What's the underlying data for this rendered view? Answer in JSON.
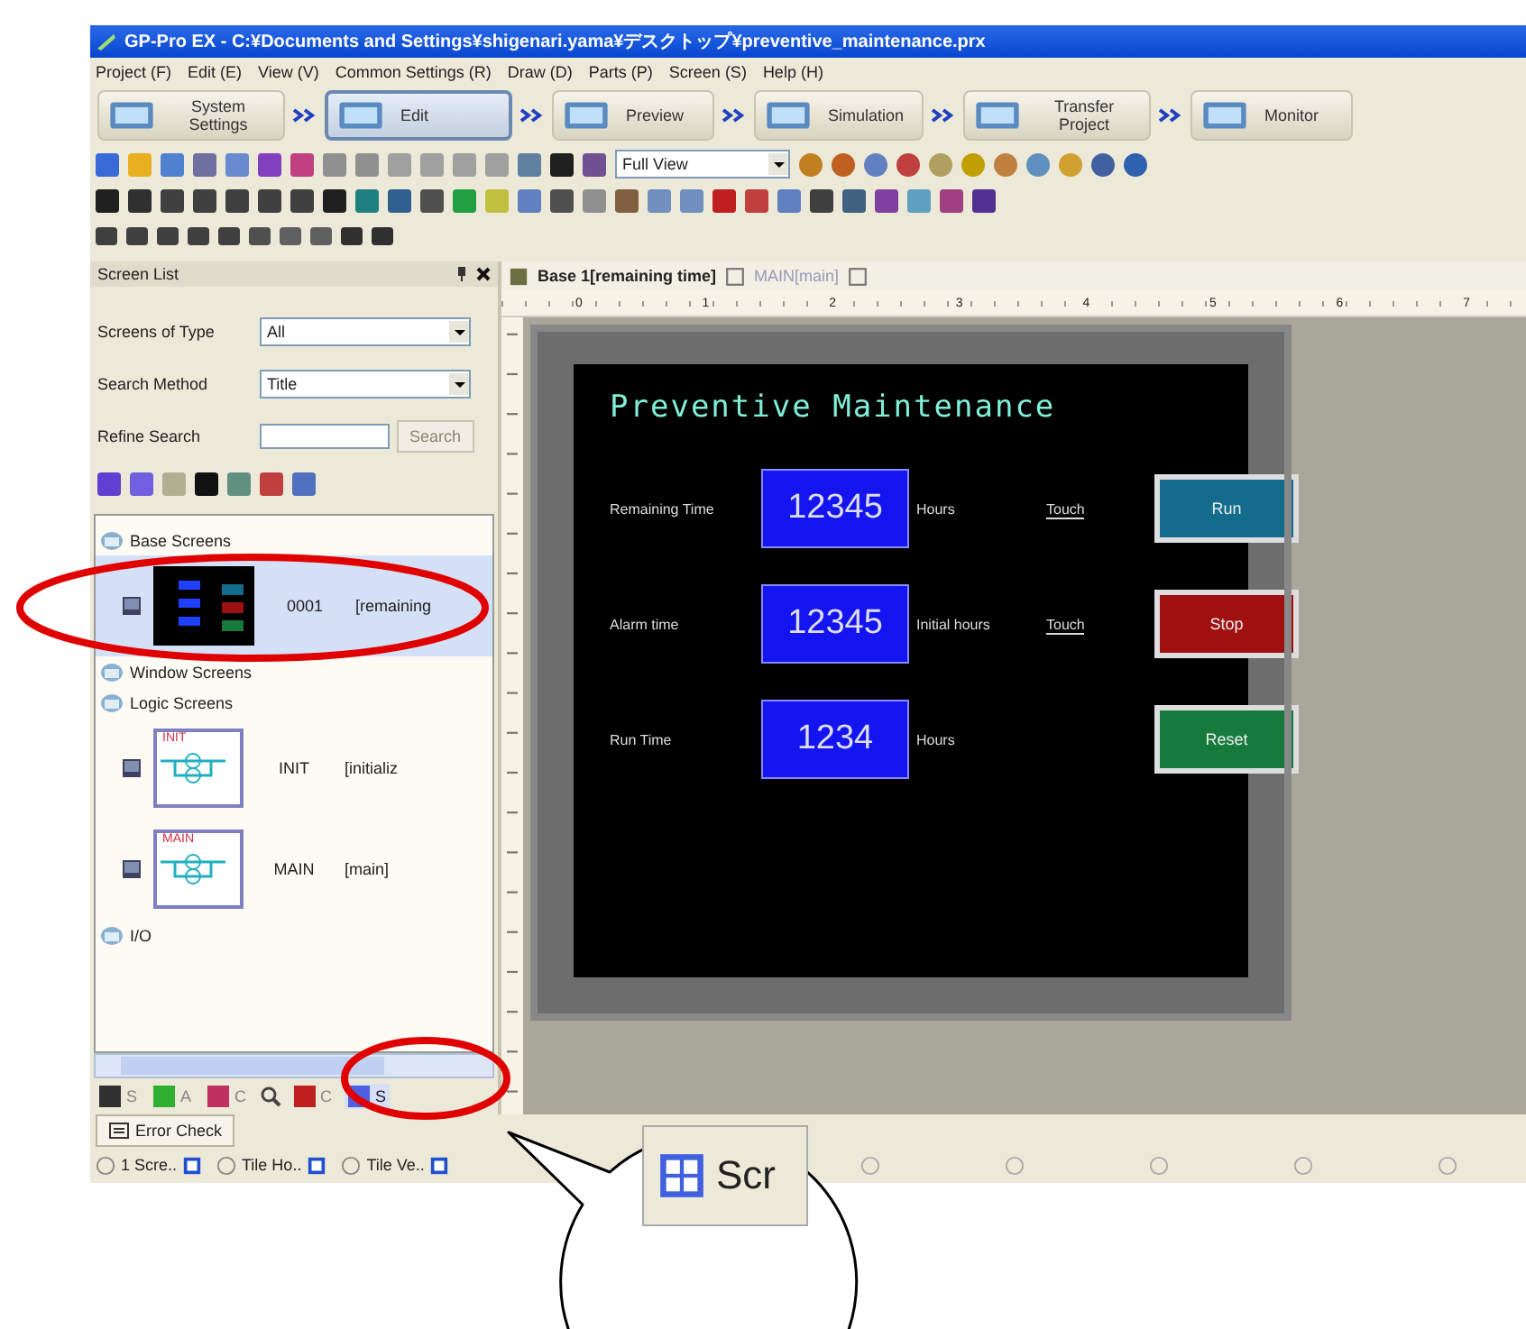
{
  "window": {
    "title": "GP-Pro EX - C:¥Documents and Settings¥shigenari.yama¥デスクトップ¥preventive_maintenance.prx"
  },
  "menu": [
    "Project (F)",
    "Edit (E)",
    "View (V)",
    "Common Settings (R)",
    "Draw (D)",
    "Parts (P)",
    "Screen (S)",
    "Help (H)"
  ],
  "workflow": [
    {
      "label": "System Settings",
      "selected": false
    },
    {
      "label": "Edit",
      "selected": true
    },
    {
      "label": "Preview",
      "selected": false
    },
    {
      "label": "Simulation",
      "selected": false
    },
    {
      "label": "Transfer Project",
      "selected": false
    },
    {
      "label": "Monitor",
      "selected": false
    }
  ],
  "toolbar": {
    "zoom": "Full View"
  },
  "screen_list": {
    "title": "Screen List",
    "fields": [
      {
        "kind": "select",
        "label": "Screens of Type",
        "value": "All"
      },
      {
        "kind": "select",
        "label": "Search Method",
        "value": "Title"
      },
      {
        "kind": "search",
        "label": "Refine Search",
        "button": "Search",
        "disabled": true
      }
    ],
    "groups": [
      {
        "label": "Base Screens",
        "children": [
          {
            "kind": "base",
            "number": "0001",
            "title": "[remaining",
            "selected": true
          }
        ]
      },
      {
        "label": "Window Screens"
      },
      {
        "label": "Logic Screens",
        "children": [
          {
            "kind": "logic",
            "thumb_label": "INIT",
            "number": "INIT",
            "title": "[initializ",
            "selected": false
          },
          {
            "kind": "logic",
            "thumb_label": "MAIN",
            "number": "MAIN",
            "title": "[main]",
            "selected": false
          }
        ]
      },
      {
        "label": "I/O"
      }
    ],
    "tabs": [
      {
        "label": "S",
        "selected": false
      },
      {
        "label": "A",
        "selected": false
      },
      {
        "label": "C",
        "selected": false
      },
      {
        "label": "C",
        "selected": false
      },
      {
        "label": "S",
        "selected": true
      }
    ]
  },
  "editor": {
    "tabs": [
      {
        "label": "Base 1[remaining time]",
        "selected": true
      },
      {
        "label": "MAIN[main]",
        "selected": false
      }
    ],
    "ruler": [
      "0",
      "1",
      "2",
      "3",
      "4",
      "5",
      "6",
      "7"
    ],
    "hmi": {
      "title": "Preventive Maintenance",
      "rows": [
        {
          "label": "Remaining Time",
          "value": "12345",
          "unit": "Hours",
          "note": "Touch",
          "button": "Run",
          "color": "#146c8c"
        },
        {
          "label": "Alarm time",
          "value": "12345",
          "unit": "Initial hours",
          "note": "Touch",
          "button": "Stop",
          "color": "#a01010"
        },
        {
          "label": "Run Time",
          "value": "1234",
          "unit": "Hours",
          "button": "Reset",
          "color": "#157a3c"
        }
      ]
    }
  },
  "error_check": "Error Check",
  "status_bar": [
    "1 Scre..",
    "Tile Ho..",
    "Tile Ve.."
  ],
  "callout": {
    "label": "Scr"
  }
}
